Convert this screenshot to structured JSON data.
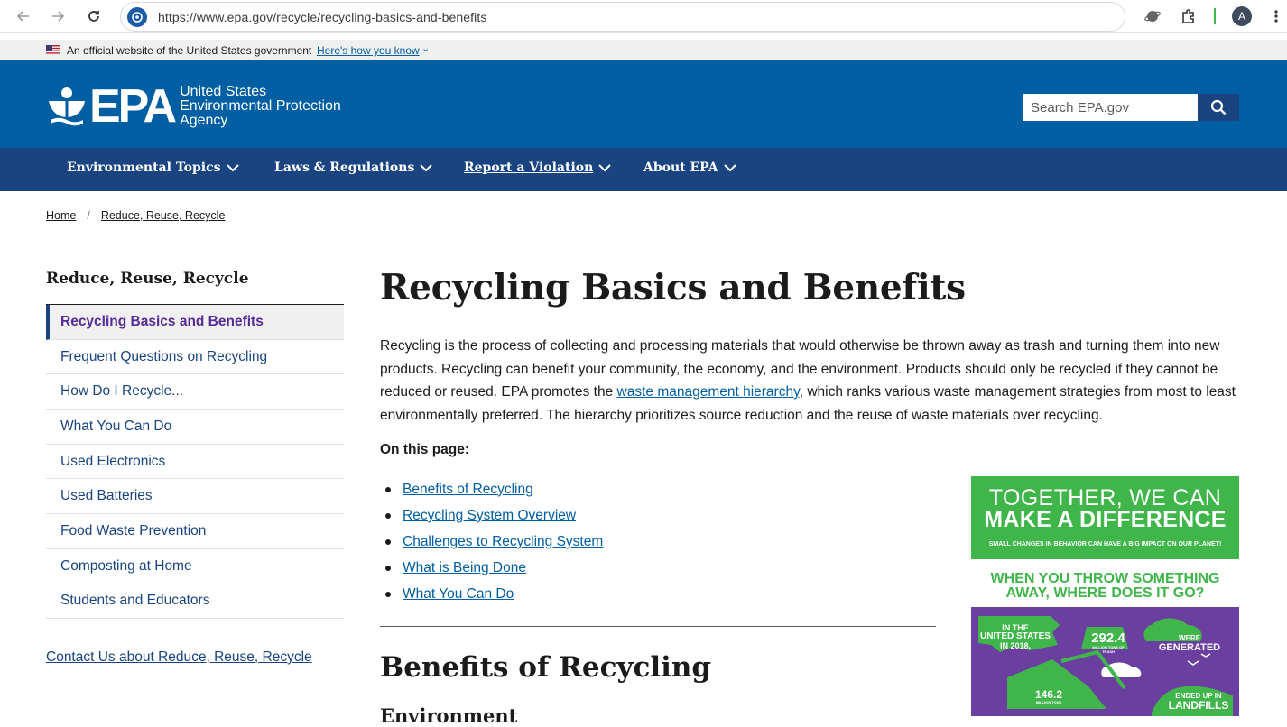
{
  "browser": {
    "url": "https://www.epa.gov/recycle/recycling-basics-and-benefits",
    "profile_initial": "A"
  },
  "gov_banner": {
    "text": "An official website of the United States government",
    "link": "Here's how you know"
  },
  "header": {
    "logo_word": "EPA",
    "agency_line1": "United States",
    "agency_line2": "Environmental Protection",
    "agency_line3": "Agency",
    "search_placeholder": "Search EPA.gov"
  },
  "nav": {
    "items": [
      {
        "label": "Environmental Topics"
      },
      {
        "label": "Laws & Regulations"
      },
      {
        "label": "Report a Violation"
      },
      {
        "label": "About EPA"
      }
    ]
  },
  "breadcrumb": {
    "home": "Home",
    "section": "Reduce, Reuse, Recycle"
  },
  "sidenav": {
    "title": "Reduce, Reuse, Recycle",
    "items": [
      {
        "label": "Recycling Basics and Benefits",
        "active": true
      },
      {
        "label": "Frequent Questions on Recycling"
      },
      {
        "label": "How Do I Recycle..."
      },
      {
        "label": "What You Can Do"
      },
      {
        "label": "Used Electronics"
      },
      {
        "label": "Used Batteries"
      },
      {
        "label": "Food Waste Prevention"
      },
      {
        "label": "Composting at Home"
      },
      {
        "label": "Students and Educators"
      }
    ],
    "contact": "Contact Us about Reduce, Reuse, Recycle"
  },
  "main": {
    "title": "Recycling Basics and Benefits",
    "intro_part1": "Recycling is the process of collecting and processing materials that would otherwise be thrown away as trash and turning them into new products. Recycling can benefit your community, the economy, and the environment. Products should only be recycled if they cannot be reduced or reused. EPA promotes the ",
    "intro_link": "waste management hierarchy",
    "intro_part2": ", which ranks various waste management strategies from most to least environmentally preferred. The hierarchy prioritizes source reduction and the reuse of waste materials over recycling.",
    "on_this_page": "On this page:",
    "toc": [
      "Benefits of Recycling",
      "Recycling System Overview",
      "Challenges to Recycling System",
      "What is Being Done",
      "What You Can Do"
    ],
    "h2": "Benefits of Recycling",
    "h3": "Environment"
  },
  "infographic": {
    "line1": "TOGETHER, WE CAN",
    "line2": "MAKE A DIFFERENCE",
    "sub": "SMALL CHANGES IN BEHAVIOR CAN HAVE A BIG IMPACT ON OUR PLANET!",
    "q1": "WHEN YOU THROW SOMETHING",
    "q2": "AWAY, WHERE DOES IT GO?",
    "stat1_a": "IN THE",
    "stat1_b": "UNITED STATES",
    "stat1_c": "IN 2018,",
    "stat_big": "292.4",
    "stat_big_unit": "MILLION TONS OF TRASH",
    "generated_a": "WERE",
    "generated_b": "GENERATED",
    "stat2": "146.2",
    "stat2_unit": "MILLION TONS",
    "landfill_a": "ENDED UP IN",
    "landfill_b": "LANDFILLS"
  },
  "colors": {
    "header_blue": "#005ea2",
    "nav_blue": "#1a4480",
    "link": "#005ea2",
    "active_nav": "#562b97",
    "ig_green": "#3fb54a",
    "ig_purple": "#6b3fa0"
  }
}
